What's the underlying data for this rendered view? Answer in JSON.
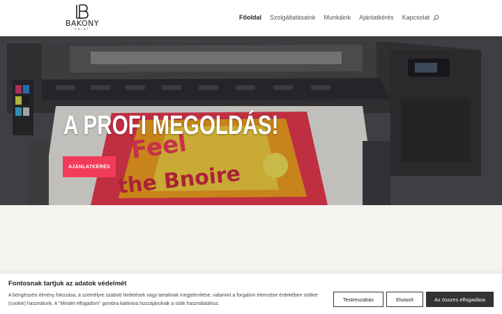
{
  "brand": {
    "name": "BAKONY",
    "sub": "PRINT"
  },
  "nav": {
    "items": [
      {
        "label": "Főoldal",
        "active": true
      },
      {
        "label": "Szolgáltatásaink",
        "active": false
      },
      {
        "label": "Munkáink",
        "active": false
      },
      {
        "label": "Ajánlatkérés",
        "active": false
      },
      {
        "label": "Kapcsolat",
        "active": false
      }
    ],
    "search_icon": "search-icon"
  },
  "hero": {
    "title": "A PROFI MEGOLDÁS!",
    "button_label": "AJÁNLATKÉRÉS",
    "print_text": "the Bnoire"
  },
  "cookie": {
    "title": "Fontosnak tartjuk az adatok védelmét",
    "text": "A böngészési élmény fokozása, a személyre szabott hirdetések vagy tartalmak megjelenítése, valamint a forgalom elemzése érdekében sütiket (cookie) használunk. A \"Mindet elfogadom\" gombra kattintva hozzájárulnak a sütik használatához.",
    "customize_label": "Testreszabás",
    "reject_label": "Elutasít",
    "accept_label": "Az összes elfogadása"
  },
  "colors": {
    "accent": "#f23b5b",
    "dark_button": "#333333"
  }
}
